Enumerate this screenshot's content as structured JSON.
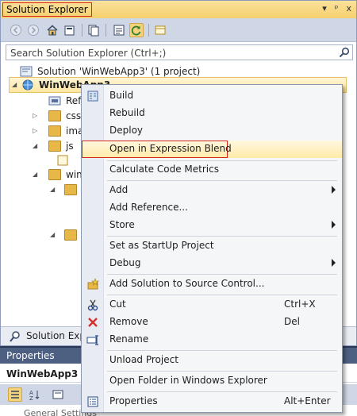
{
  "solution_explorer": {
    "title": "Solution Explorer",
    "title_controls": [
      "▾",
      "ᵖ",
      "x"
    ],
    "search_placeholder": "Search Solution Explorer (Ctrl+;)",
    "tree": {
      "solution_label": "Solution 'WinWebApp3' (1 project)",
      "project_label": "WinWebApp3",
      "references_label": "Ref",
      "css_label": "css",
      "images_label": "ima",
      "js_label": "js",
      "winjs_label": "win"
    },
    "bottom_tab_label": "Solution Explor"
  },
  "properties": {
    "title": "Properties",
    "selected_object": "WinWebApp3",
    "category_partial": "General Settings"
  },
  "context_menu": {
    "items": [
      {
        "label": "Build",
        "shortcut": "",
        "submenu": false,
        "icon": "build-icon"
      },
      {
        "label": "Rebuild",
        "shortcut": "",
        "submenu": false,
        "icon": ""
      },
      {
        "label": "Deploy",
        "shortcut": "",
        "submenu": false,
        "icon": ""
      },
      {
        "label": "Open in Expression Blend",
        "shortcut": "",
        "submenu": false,
        "icon": "",
        "highlighted": true
      },
      {
        "label": "Calculate Code Metrics",
        "shortcut": "",
        "submenu": false,
        "icon": ""
      },
      {
        "label": "Add",
        "shortcut": "",
        "submenu": true,
        "icon": ""
      },
      {
        "label": "Add Reference...",
        "shortcut": "",
        "submenu": false,
        "icon": ""
      },
      {
        "label": "Store",
        "shortcut": "",
        "submenu": true,
        "icon": ""
      },
      {
        "label": "Set as StartUp Project",
        "shortcut": "",
        "submenu": false,
        "icon": ""
      },
      {
        "label": "Debug",
        "shortcut": "",
        "submenu": true,
        "icon": ""
      },
      {
        "label": "Add Solution to Source Control...",
        "shortcut": "",
        "submenu": false,
        "icon": "source-control-icon"
      },
      {
        "label": "Cut",
        "shortcut": "Ctrl+X",
        "submenu": false,
        "icon": "scissors-icon"
      },
      {
        "label": "Remove",
        "shortcut": "Del",
        "submenu": false,
        "icon": "remove-x-icon"
      },
      {
        "label": "Rename",
        "shortcut": "",
        "submenu": false,
        "icon": "rename-icon"
      },
      {
        "label": "Unload Project",
        "shortcut": "",
        "submenu": false,
        "icon": ""
      },
      {
        "label": "Open Folder in Windows Explorer",
        "shortcut": "",
        "submenu": false,
        "icon": ""
      },
      {
        "label": "Properties",
        "shortcut": "Alt+Enter",
        "submenu": false,
        "icon": "properties-icon"
      }
    ]
  },
  "colors": {
    "accent_highlight_border": "#d9261c",
    "title_bar_gold": "#f5d06e",
    "panel_dark": "#293955"
  }
}
